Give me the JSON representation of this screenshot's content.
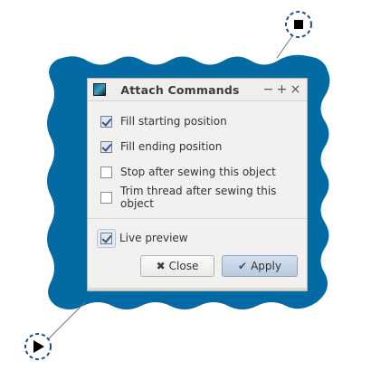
{
  "dialog": {
    "title": "Attach Commands",
    "controls": {
      "minimize": "−",
      "maximize": "+",
      "close": "×"
    }
  },
  "options": [
    {
      "label": "Fill starting position",
      "checked": true
    },
    {
      "label": "Fill ending position",
      "checked": true
    },
    {
      "label": "Stop after sewing this object",
      "checked": false
    },
    {
      "label": "Trim thread after sewing this object",
      "checked": false
    }
  ],
  "live_preview": {
    "label": "Live preview",
    "checked": true
  },
  "buttons": {
    "close_label": "Close",
    "close_icon": "✖",
    "apply_label": "Apply",
    "apply_icon": "✔"
  },
  "colors": {
    "wavy_shape": "#046aa3",
    "dialog_bg": "#f2f1f0",
    "handle_border": "#1f4e8c"
  },
  "icons": {
    "top_handle": "stop-square-icon",
    "bottom_handle": "play-triangle-icon"
  }
}
